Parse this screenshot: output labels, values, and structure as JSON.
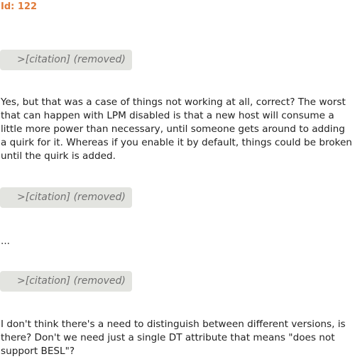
{
  "header": {
    "id_label": "Id: 122"
  },
  "message": {
    "blocks": [
      {
        "type": "citation",
        "text": ">[citation] (removed)"
      },
      {
        "type": "paragraph",
        "text": "Yes, but that was a case of things not working at all, correct? The worst that can happen with LPM disabled is that a new host will consume a little more power than necessary, until someone gets around to adding a quirk for it. Whereas if you enable it by default, things could be broken until the quirk is added."
      },
      {
        "type": "citation",
        "text": ">[citation] (removed)"
      },
      {
        "type": "paragraph",
        "text": "..."
      },
      {
        "type": "citation",
        "text": ">[citation] (removed)"
      },
      {
        "type": "paragraph",
        "text": "I don't think there's a need to distinguish between different versions, is there? Don't we need just a single DT attribute that means \"does not support BESL\"?"
      }
    ]
  },
  "colors": {
    "id_label": "#e07b39",
    "citation_background": "#e3e4e0",
    "citation_text": "#707070",
    "body_text": "#222222"
  }
}
